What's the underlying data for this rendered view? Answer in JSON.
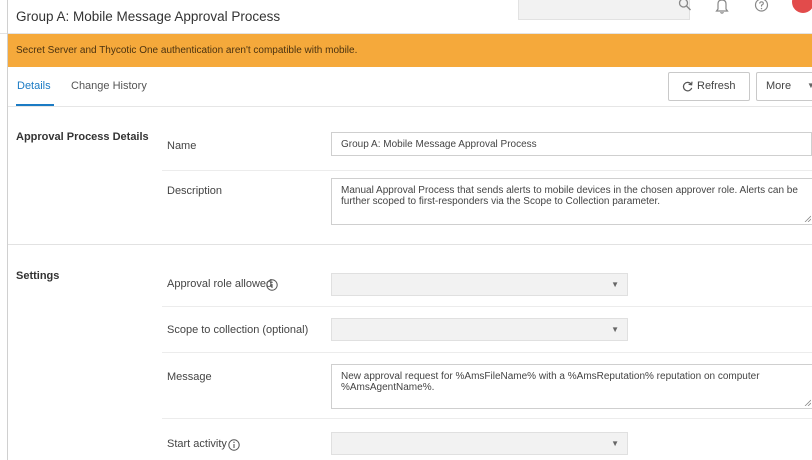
{
  "header": {
    "title": "Group A: Mobile Message Approval Process"
  },
  "alert": {
    "text": "Secret Server and Thycotic One authentication aren't compatible with mobile.",
    "color": "#f5a93b"
  },
  "tabs": [
    {
      "label": "Details",
      "active": true
    },
    {
      "label": "Change History",
      "active": false
    }
  ],
  "toolbar": {
    "refresh_label": "Refresh",
    "more_label": "More"
  },
  "sections": {
    "details_title": "Approval Process Details",
    "settings_title": "Settings"
  },
  "fields": {
    "name_label": "Name",
    "name_value": "Group A:  Mobile Message Approval Process",
    "description_label": "Description",
    "description_value": "Manual Approval Process that sends alerts to mobile devices in the chosen approver role. Alerts can be further scoped to first-responders via the Scope to Collection parameter.",
    "approval_role_label": "Approval role allowed",
    "approval_role_value": "",
    "scope_label": "Scope to collection (optional)",
    "scope_value": "",
    "message_label": "Message",
    "message_value": "New approval request for %AmsFileName% with a %AmsReputation% reputation on computer %AmsAgentName%.",
    "start_activity_label": "Start activity",
    "start_activity_value": ""
  },
  "colors": {
    "accent": "#1b7bc4",
    "avatar": "#e24b4b"
  }
}
